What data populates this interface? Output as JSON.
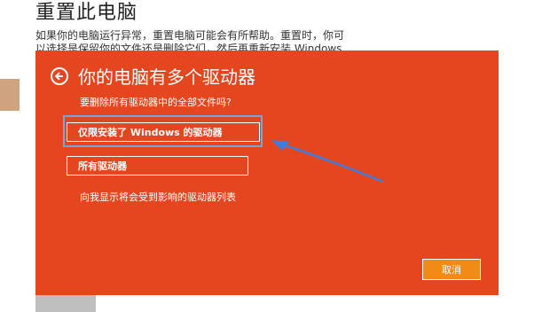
{
  "background": {
    "title": "重置此电脑",
    "description": "如果你的电脑运行异常，重置电脑可能会有所帮助。重置时，你可以选择是保留你的文件还是删除它们，然后再重新安装 Windows"
  },
  "dialog": {
    "title": "你的电脑有多个驱动器",
    "question": "要删除所有驱动器中的全部文件吗?",
    "option_windows_drive": "仅限安装了 Windows 的驱动器",
    "option_all_drives": "所有驱动器",
    "show_drives_link": "向我显示将会受到影响的驱动器列表",
    "cancel_label": "取消"
  },
  "colors": {
    "dialog_bg": "#e4461f",
    "highlight": "#6fa8dc",
    "arrow": "#3d7de0",
    "cancel_bg": "#f28a16"
  },
  "icons": {
    "back": "back-arrow-circle-icon",
    "annotation": "annotation-arrow-icon"
  }
}
